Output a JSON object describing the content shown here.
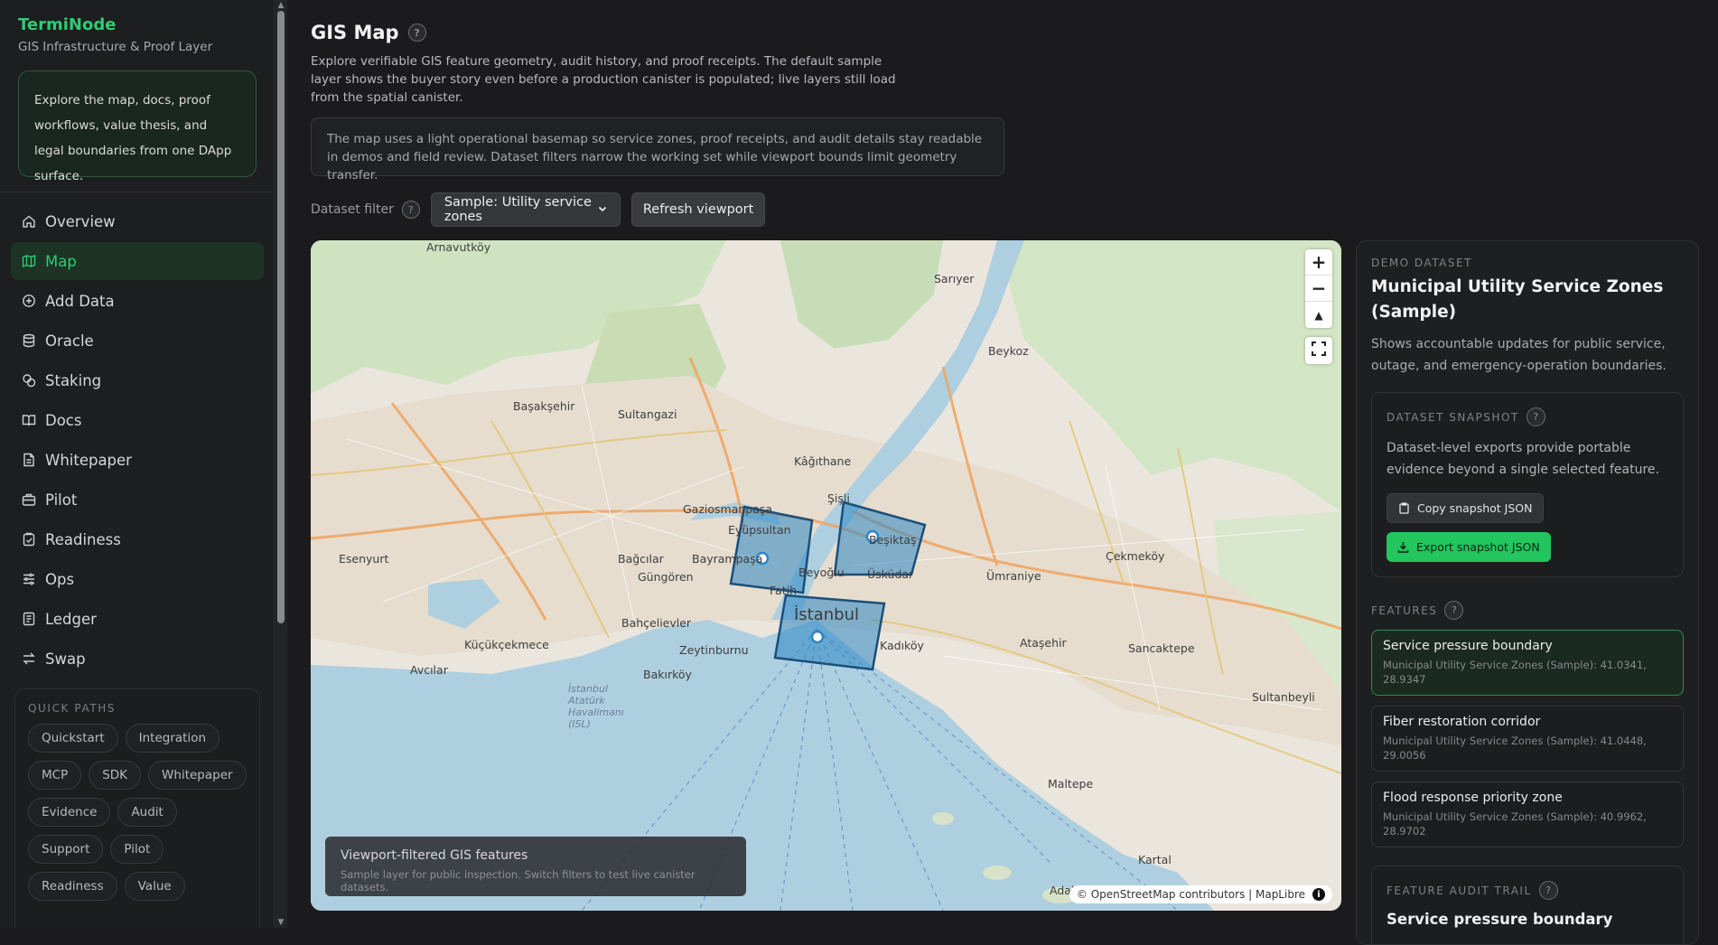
{
  "sidebar": {
    "brand": "TermiNode",
    "subtitle": "GIS Infrastructure & Proof Layer",
    "intro": "Explore the map, docs, proof workflows, value thesis, and legal boundaries from one DApp surface.",
    "nav": [
      {
        "label": "Overview",
        "icon": "home-icon"
      },
      {
        "label": "Map",
        "icon": "map-icon",
        "active": true
      },
      {
        "label": "Add Data",
        "icon": "plus-circle-icon"
      },
      {
        "label": "Oracle",
        "icon": "database-icon"
      },
      {
        "label": "Staking",
        "icon": "coins-icon"
      },
      {
        "label": "Docs",
        "icon": "book-icon"
      },
      {
        "label": "Whitepaper",
        "icon": "file-text-icon"
      },
      {
        "label": "Pilot",
        "icon": "briefcase-icon"
      },
      {
        "label": "Readiness",
        "icon": "clipboard-check-icon"
      },
      {
        "label": "Ops",
        "icon": "sliders-icon"
      },
      {
        "label": "Ledger",
        "icon": "ledger-icon"
      },
      {
        "label": "Swap",
        "icon": "swap-arrows-icon"
      }
    ],
    "quick_paths": {
      "title": "QUICK PATHS",
      "chips": [
        "Quickstart",
        "Integration",
        "MCP",
        "SDK",
        "Whitepaper",
        "Evidence",
        "Audit",
        "Support",
        "Pilot",
        "Readiness",
        "Value"
      ]
    }
  },
  "main": {
    "title": "GIS Map",
    "description": "Explore verifiable GIS feature geometry, audit history, and proof receipts. The default sample layer shows the buyer story even before a production canister is populated; live layers still load from the spatial canister.",
    "notice": "The map uses a light operational basemap so service zones, proof receipts, and audit details stay readable in demos and field review. Dataset filters narrow the working set while viewport bounds limit geometry transfer.",
    "filter_label": "Dataset filter",
    "filter_value": "Sample: Utility service zones",
    "refresh_label": "Refresh viewport"
  },
  "map": {
    "overlay_title": "Viewport-filtered GIS features",
    "overlay_sub": "Sample layer for public inspection. Switch filters to test live canister datasets.",
    "attribution": "© OpenStreetMap contributors | MapLibre",
    "controls": {
      "zoom_in": "+",
      "zoom_out": "−",
      "compass": "▲"
    },
    "labels": {
      "arnavutkoy": "Arnavutköy",
      "sariyer": "Sarıyer",
      "beykoz": "Beykoz",
      "basaksehir": "Başakşehir",
      "sultangazi": "Sultangazi",
      "kagithane": "Kâğıthane",
      "gaziosmanpasa": "Gaziosmanpaşa",
      "eyupsultan": "Eyüpsultan",
      "sisli": "Şişli",
      "besiktas": "Beşiktaş",
      "esenyurt": "Esenyurt",
      "bagcilar": "Bağcılar",
      "gungoren": "Güngören",
      "bayrampasa": "Bayrampaşa",
      "beyoglu": "Beyoğlu",
      "uskudar": "Üsküdar",
      "umraniye": "Ümraniye",
      "cekmekoy": "Çekmeköy",
      "fatih": "Fatih",
      "istanbul": "İstanbul",
      "bahcelievler": "Bahçelievler",
      "kucukcekmece": "Küçükçekmece",
      "zeytinburnu": "Zeytinburnu",
      "bakirkoy": "Bakırköy",
      "kadikoy": "Kadıköy",
      "atasehir": "Ataşehir",
      "sancaktepe": "Sancaktepe",
      "sultanbeyli": "Sultanbeyli",
      "avcilar": "Avcılar",
      "maltepe": "Maltepe",
      "kartal": "Kartal",
      "adalar": "Adalar",
      "airport": "İstanbul Atatürk Havalimanı (ISL)"
    }
  },
  "panel": {
    "eyebrow": "DEMO DATASET",
    "title": "Municipal Utility Service Zones (Sample)",
    "description": "Shows accountable updates for public service, outage, and emergency-operation boundaries.",
    "snapshot": {
      "eyebrow": "DATASET SNAPSHOT",
      "description": "Dataset-level exports provide portable evidence beyond a single selected feature.",
      "copy_label": "Copy snapshot JSON",
      "export_label": "Export snapshot JSON"
    },
    "features_label": "FEATURES",
    "features": [
      {
        "name": "Service pressure boundary",
        "meta": "Municipal Utility Service Zones (Sample): 41.0341, 28.9347",
        "selected": true
      },
      {
        "name": "Fiber restoration corridor",
        "meta": "Municipal Utility Service Zones (Sample): 41.0448, 29.0056",
        "selected": false
      },
      {
        "name": "Flood response priority zone",
        "meta": "Municipal Utility Service Zones (Sample): 40.9962, 28.9702",
        "selected": false
      }
    ],
    "audit": {
      "eyebrow": "FEATURE AUDIT TRAIL",
      "title": "Service pressure boundary"
    }
  },
  "colors": {
    "accent": "#2ecc71",
    "export_button": "#22c55e",
    "zone_fill": "#2b86c5",
    "zone_stroke": "#1a4f7a"
  }
}
